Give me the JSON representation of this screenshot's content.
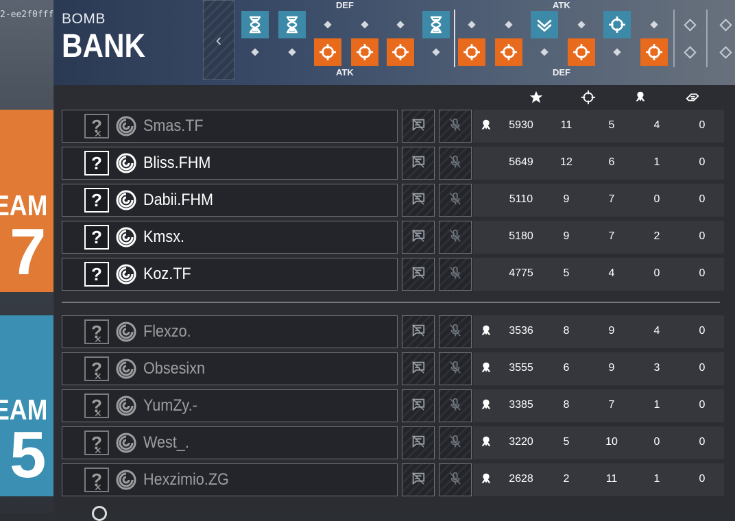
{
  "header": {
    "hash_fragment": "2-ee2f0fff",
    "mode": "BOMB",
    "map": "BANK",
    "collapse_glyph": "‹",
    "side_labels": {
      "def_top": "DEF",
      "atk_top": "ATK",
      "atk_bottom": "ATK",
      "def_bottom": "DEF"
    },
    "rounds_top": [
      "hourglass-blue",
      "hourglass-blue",
      "diamond",
      "diamond",
      "diamond",
      "hourglass-blue",
      "diamond",
      "diamond",
      "defuser-blue",
      "diamond",
      "crosshair-blue",
      "diamond",
      "diamond-hollow",
      "diamond-hollow"
    ],
    "rounds_bottom": [
      "diamond",
      "diamond",
      "crosshair-orange",
      "crosshair-orange",
      "crosshair-orange",
      "diamond",
      "crosshair-orange",
      "crosshair-orange",
      "diamond",
      "crosshair-orange",
      "diamond",
      "crosshair-orange",
      "diamond-hollow",
      "diamond-hollow"
    ]
  },
  "stat_headers": [
    "score-star-icon",
    "kills-crosshair-icon",
    "deaths-skull-icon",
    "assists-hand-icon"
  ],
  "teams": [
    {
      "word": "EAM",
      "number": "7",
      "color": "#e07a35",
      "players": [
        {
          "name": "Smas.TF",
          "score": "5930",
          "kills": "11",
          "deaths": "5",
          "assists": "4",
          "extra": "0",
          "dead": true
        },
        {
          "name": "Bliss.FHM",
          "score": "5649",
          "kills": "12",
          "deaths": "6",
          "assists": "1",
          "extra": "0",
          "dead": false
        },
        {
          "name": "Dabii.FHM",
          "score": "5110",
          "kills": "9",
          "deaths": "7",
          "assists": "0",
          "extra": "0",
          "dead": false
        },
        {
          "name": "Kmsx.",
          "score": "5180",
          "kills": "9",
          "deaths": "7",
          "assists": "2",
          "extra": "0",
          "dead": false
        },
        {
          "name": "Koz.TF",
          "score": "4775",
          "kills": "5",
          "deaths": "4",
          "assists": "0",
          "extra": "0",
          "dead": false
        }
      ]
    },
    {
      "word": "EAM",
      "number": "5",
      "color": "#3a8fb2",
      "players": [
        {
          "name": "Flexzo.",
          "score": "3536",
          "kills": "8",
          "deaths": "9",
          "assists": "4",
          "extra": "0",
          "dead": true
        },
        {
          "name": "Obsesixn",
          "score": "3555",
          "kills": "6",
          "deaths": "9",
          "assists": "3",
          "extra": "0",
          "dead": true
        },
        {
          "name": "YumZy.-",
          "score": "3385",
          "kills": "8",
          "deaths": "7",
          "assists": "1",
          "extra": "0",
          "dead": true
        },
        {
          "name": "West_.",
          "score": "3220",
          "kills": "5",
          "deaths": "10",
          "assists": "0",
          "extra": "0",
          "dead": true
        },
        {
          "name": "Hexzimio.ZG",
          "score": "2628",
          "kills": "2",
          "deaths": "11",
          "assists": "1",
          "extra": "0",
          "dead": true
        }
      ]
    }
  ]
}
